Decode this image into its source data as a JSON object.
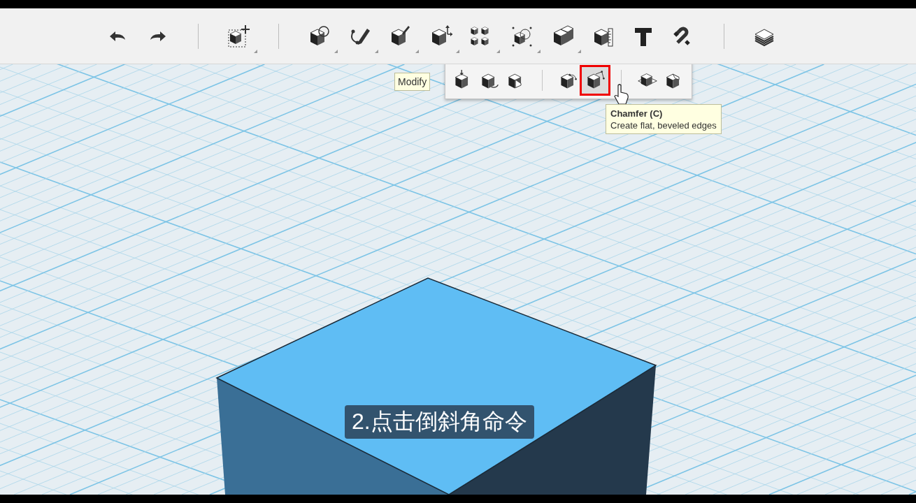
{
  "toolbar": {
    "tools": [
      {
        "kind": "undo",
        "has_menu": false
      },
      {
        "kind": "redo",
        "has_menu": false
      },
      {
        "kind": "separator"
      },
      {
        "kind": "transform",
        "has_menu": true
      },
      {
        "kind": "separator"
      },
      {
        "kind": "primitives",
        "has_menu": true
      },
      {
        "kind": "sketch",
        "has_menu": true
      },
      {
        "kind": "construct",
        "has_menu": true
      },
      {
        "kind": "modify",
        "has_menu": true
      },
      {
        "kind": "pattern",
        "has_menu": true
      },
      {
        "kind": "grouping",
        "has_menu": true
      },
      {
        "kind": "combine",
        "has_menu": true
      },
      {
        "kind": "measure",
        "has_menu": false
      },
      {
        "kind": "text",
        "has_menu": false
      },
      {
        "kind": "snap",
        "has_menu": false
      },
      {
        "kind": "separator"
      },
      {
        "kind": "material",
        "has_menu": false
      }
    ]
  },
  "modify_menu": {
    "label_tooltip": "Modify",
    "tools": [
      {
        "kind": "press-pull",
        "selected": false
      },
      {
        "kind": "tweak",
        "selected": false
      },
      {
        "kind": "split-face",
        "selected": false
      },
      {
        "kind": "separator"
      },
      {
        "kind": "fillet",
        "selected": false
      },
      {
        "kind": "chamfer",
        "selected": true
      },
      {
        "kind": "separator"
      },
      {
        "kind": "shell",
        "selected": false
      },
      {
        "kind": "split-solid",
        "selected": false
      }
    ]
  },
  "tooltip": {
    "title": "Chamfer (C)",
    "description": "Create flat, beveled edges"
  },
  "subtitle": "2.点击倒斜角命令"
}
